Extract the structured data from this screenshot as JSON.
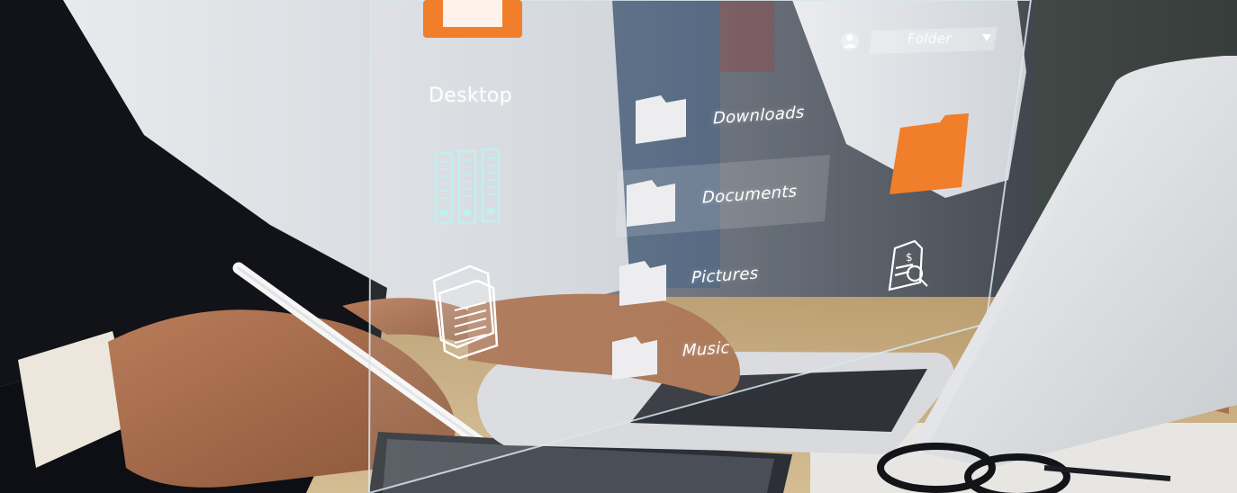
{
  "hologram": {
    "desktop_label": "Desktop",
    "folder_dropdown_label": "Folder",
    "folders": [
      {
        "label": "Downloads"
      },
      {
        "label": "Documents"
      },
      {
        "label": "Pictures"
      },
      {
        "label": "Music"
      }
    ]
  },
  "colors": {
    "accent_orange": "#F07E2A",
    "folder_white": "#EDEDEF",
    "glass_edge": "#D8E6EC"
  },
  "icons": [
    "folder-icon",
    "server-icon",
    "documents-stack-icon",
    "user-icon",
    "dropdown-arrow-icon",
    "invoice-search-icon"
  ]
}
